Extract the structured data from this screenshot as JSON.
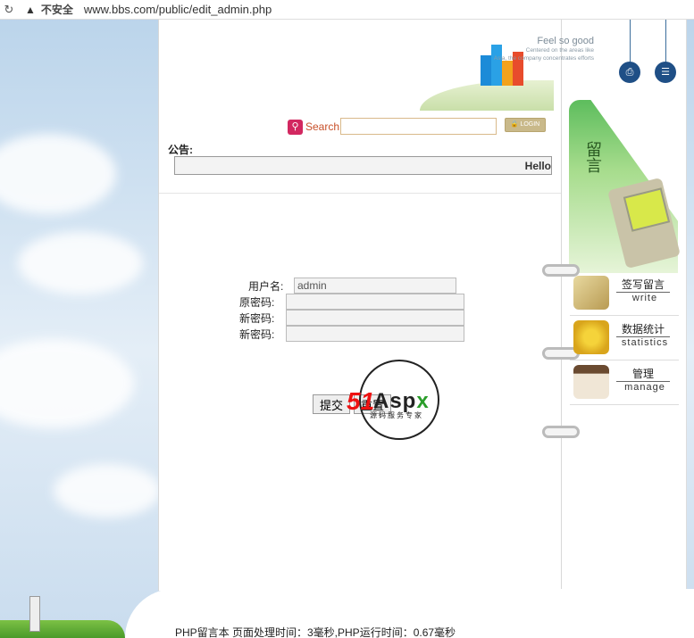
{
  "browser": {
    "insecure_label": "不安全",
    "url": "www.bbs.com/public/edit_admin.php"
  },
  "header": {
    "tagline_1": "Feel so good",
    "tagline_2": "Centered on the areas like",
    "tagline_3": "Asia, the company concentrates efforts",
    "search_label": "Search",
    "search_value": "",
    "login_label": "LOGIN"
  },
  "notice": {
    "label": "公告:",
    "text": "Hello"
  },
  "form": {
    "username_label": "用户名:",
    "username_value": "admin",
    "old_password_label": "原密码:",
    "new_password_label": "新密码:",
    "confirm_password_label": "新密码:",
    "submit_label": "提交",
    "reset_label": "重置"
  },
  "watermark": {
    "brand_51": "51",
    "brand_aspx_prefix": "Asp",
    "brand_aspx_x": "x",
    "subtitle": "源码服务专家"
  },
  "sidebar": {
    "banner_text": "留言",
    "items": [
      {
        "cn": "签写留言",
        "en": "write"
      },
      {
        "cn": "数据统计",
        "en": "statistics"
      },
      {
        "cn": "管理",
        "en": "manage"
      }
    ]
  },
  "footer": {
    "text": "PHP留言本  页面处理时间：3毫秒,PHP运行时间：0.67毫秒"
  },
  "colors": {
    "search_accent": "#d22860",
    "login_button": "#c9b98a",
    "pin_icon": "#1f4f86",
    "banner_green": "#5dbd5d"
  }
}
